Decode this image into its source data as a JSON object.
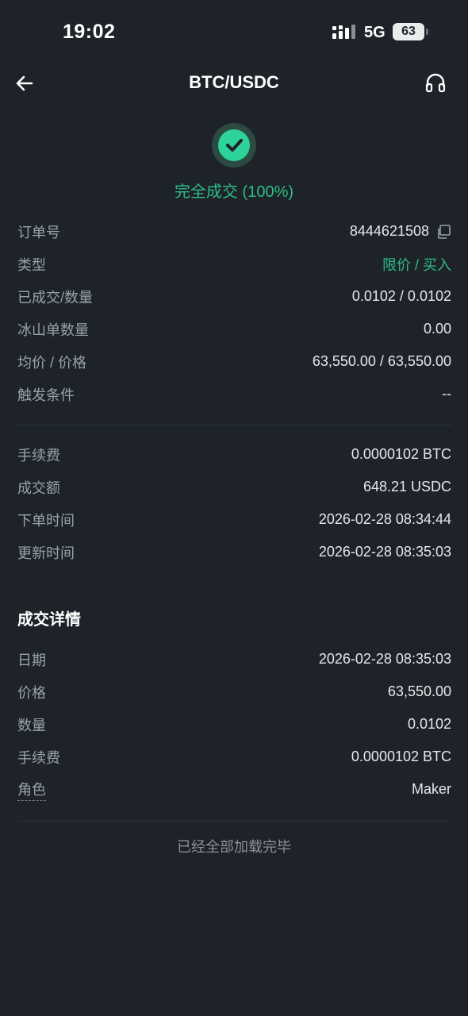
{
  "status_bar": {
    "time": "19:02",
    "network": "5G",
    "battery": "63"
  },
  "header": {
    "title": "BTC/USDC"
  },
  "order_status": {
    "text": "完全成交 (100%)"
  },
  "order_info": [
    {
      "label": "订单号",
      "value": "8444621508"
    },
    {
      "label": "类型",
      "value": "限价 / 买入"
    },
    {
      "label": "已成交/数量",
      "value": "0.0102 / 0.0102"
    },
    {
      "label": "冰山单数量",
      "value": "0.00"
    },
    {
      "label": "均价 / 价格",
      "value": "63,550.00 / 63,550.00"
    },
    {
      "label": "触发条件",
      "value": "--"
    }
  ],
  "order_fees": [
    {
      "label": "手续费",
      "value": "0.0000102 BTC"
    },
    {
      "label": "成交额",
      "value": "648.21 USDC"
    },
    {
      "label": "下单时间",
      "value": "2026-02-28 08:34:44"
    },
    {
      "label": "更新时间",
      "value": "2026-02-28 08:35:03"
    }
  ],
  "trade_details": {
    "title": "成交详情",
    "rows": [
      {
        "label": "日期",
        "value": "2026-02-28 08:35:03"
      },
      {
        "label": "价格",
        "value": "63,550.00"
      },
      {
        "label": "数量",
        "value": "0.0102"
      },
      {
        "label": "手续费",
        "value": "0.0000102 BTC"
      },
      {
        "label": "角色",
        "value": "Maker"
      }
    ]
  },
  "footer": {
    "text": "已经全部加载完毕"
  },
  "colors": {
    "background": "#1e232a",
    "accent_green": "#2ebd85",
    "divider": "#2c323a"
  },
  "icons": {
    "back": "arrow-left-icon",
    "support": "headset-icon",
    "status": "check-circle-icon",
    "copy": "copy-icon"
  }
}
